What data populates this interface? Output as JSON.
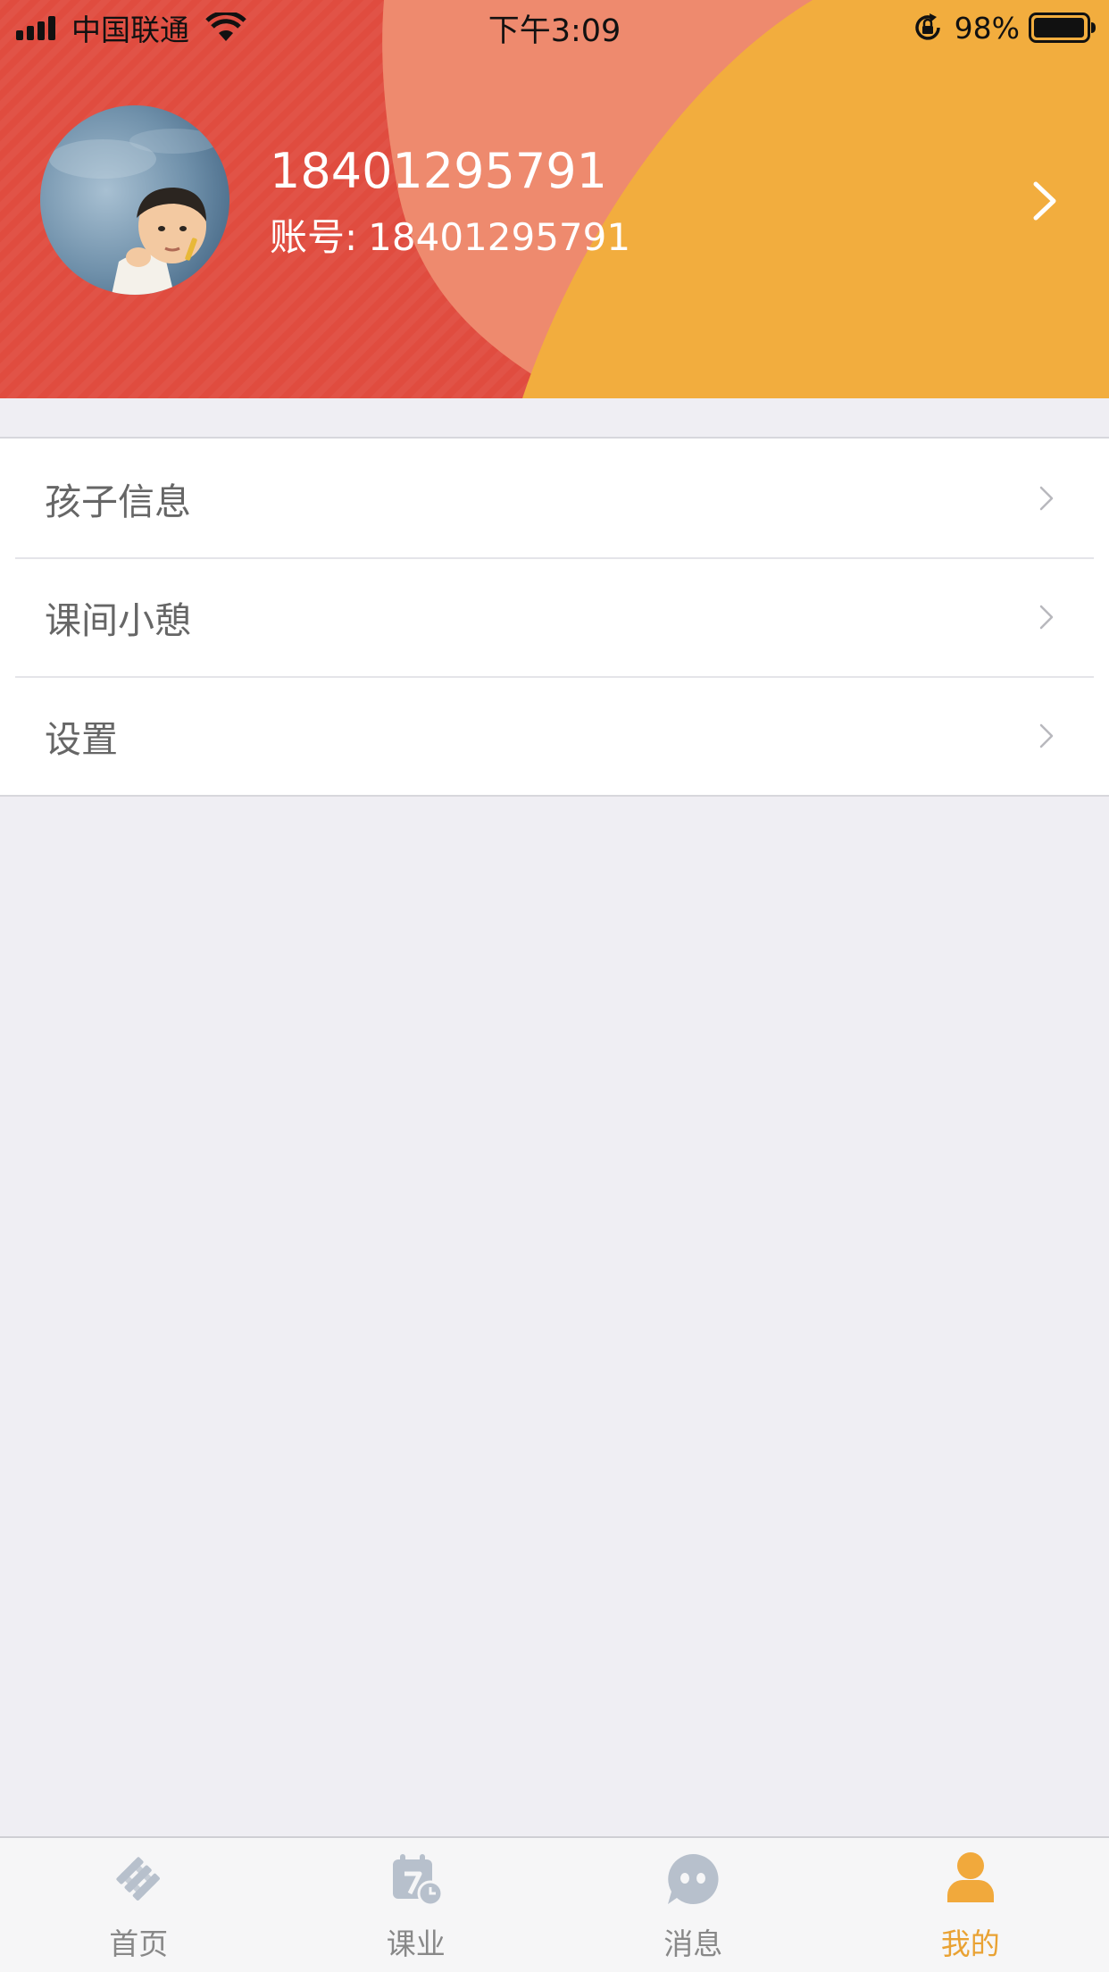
{
  "status_bar": {
    "carrier": "中国联通",
    "time": "下午3:09",
    "battery_percent": "98%"
  },
  "profile": {
    "name": "18401295791",
    "account_prefix": "账号:",
    "account": "18401295791"
  },
  "menu": {
    "items": [
      {
        "label": "孩子信息"
      },
      {
        "label": "课间小憩"
      },
      {
        "label": "设置"
      }
    ]
  },
  "tab_bar": {
    "tabs": [
      {
        "label": "首页",
        "icon": "home-icon",
        "active": false
      },
      {
        "label": "课业",
        "icon": "calendar-icon",
        "active": false
      },
      {
        "label": "消息",
        "icon": "message-icon",
        "active": false
      },
      {
        "label": "我的",
        "icon": "user-icon",
        "active": true
      }
    ]
  },
  "colors": {
    "header_red": "#e04c3f",
    "header_salmon": "#ee8a6e",
    "header_orange": "#f2ad3e",
    "tab_active": "#e9a233",
    "tab_inactive": "#b7c0cc",
    "background": "#efeef3"
  }
}
